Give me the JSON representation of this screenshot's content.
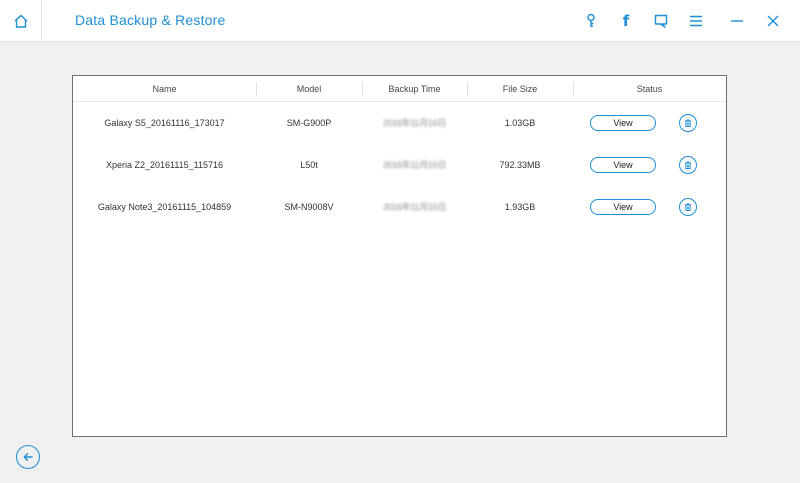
{
  "window": {
    "title": "Data Backup & Restore",
    "accent": "#1d8fd6"
  },
  "titlebar_icons": {
    "home": "home-icon",
    "key": "key-icon",
    "facebook": "f",
    "feedback": "chat-icon",
    "menu": "menu-icon",
    "minimize": "minimize-icon",
    "close": "close-icon"
  },
  "table": {
    "columns": [
      "Name",
      "Model",
      "Backup Time",
      "File Size",
      "Status"
    ],
    "rows": [
      {
        "name": "Galaxy S5_20161116_173017",
        "model": "SM-G900P",
        "backup_time": "2016年11月16日",
        "file_size": "1.03GB",
        "action": "View"
      },
      {
        "name": "Xperia Z2_20161115_115716",
        "model": "L50t",
        "backup_time": "2016年11月15日",
        "file_size": "792.33MB",
        "action": "View"
      },
      {
        "name": "Galaxy Note3_20161115_104859",
        "model": "SM-N9008V",
        "backup_time": "2016年11月15日",
        "file_size": "1.93GB",
        "action": "View"
      }
    ]
  },
  "footer": {
    "back_icon": "arrow-left-icon"
  }
}
